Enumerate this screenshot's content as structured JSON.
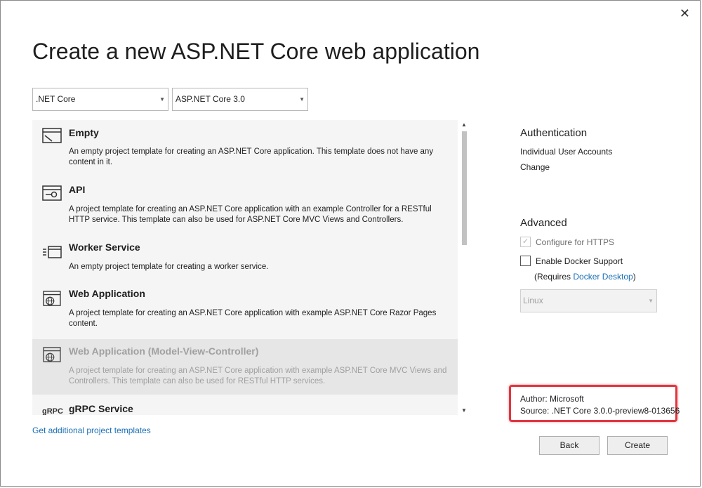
{
  "title": "Create a new ASP.NET Core web application",
  "framework_select": {
    "value": ".NET Core"
  },
  "version_select": {
    "value": "ASP.NET Core 3.0"
  },
  "templates": [
    {
      "name": "Empty",
      "icon": "empty-template-icon",
      "description": "An empty project template for creating an ASP.NET Core application. This template does not have any content in it."
    },
    {
      "name": "API",
      "icon": "api-template-icon",
      "description": "A project template for creating an ASP.NET Core application with an example Controller for a RESTful HTTP service. This template can also be used for ASP.NET Core MVC Views and Controllers."
    },
    {
      "name": "Worker Service",
      "icon": "worker-service-icon",
      "description": "An empty project template for creating a worker service."
    },
    {
      "name": "Web Application",
      "icon": "web-application-icon",
      "description": "A project template for creating an ASP.NET Core application with example ASP.NET Core Razor Pages content."
    },
    {
      "name": "Web Application (Model-View-Controller)",
      "icon": "web-mvc-icon",
      "description": "A project template for creating an ASP.NET Core application with example ASP.NET Core MVC Views and Controllers. This template can also be used for RESTful HTTP services."
    },
    {
      "name": "gRPC Service",
      "icon_text": "gRPC"
    }
  ],
  "get_templates_link": "Get additional project templates",
  "authentication": {
    "heading": "Authentication",
    "value": "Individual User Accounts",
    "change_link": "Change"
  },
  "advanced": {
    "heading": "Advanced",
    "https_label": "Configure for HTTPS",
    "https_checked": true,
    "docker_label": "Enable Docker Support",
    "docker_checked": false,
    "requires_prefix": "(Requires ",
    "docker_desktop_link": "Docker Desktop",
    "requires_suffix": ")",
    "os_value": "Linux"
  },
  "info": {
    "author_label": "Author:",
    "author_value": "Microsoft",
    "source_label": "Source:",
    "source_value": ".NET Core 3.0.0-preview8-013656"
  },
  "buttons": {
    "back": "Back",
    "create": "Create"
  },
  "colors": {
    "link": "#1a6fb5",
    "highlight_border": "#e0363f",
    "selected_row": "#e6e6e6"
  }
}
